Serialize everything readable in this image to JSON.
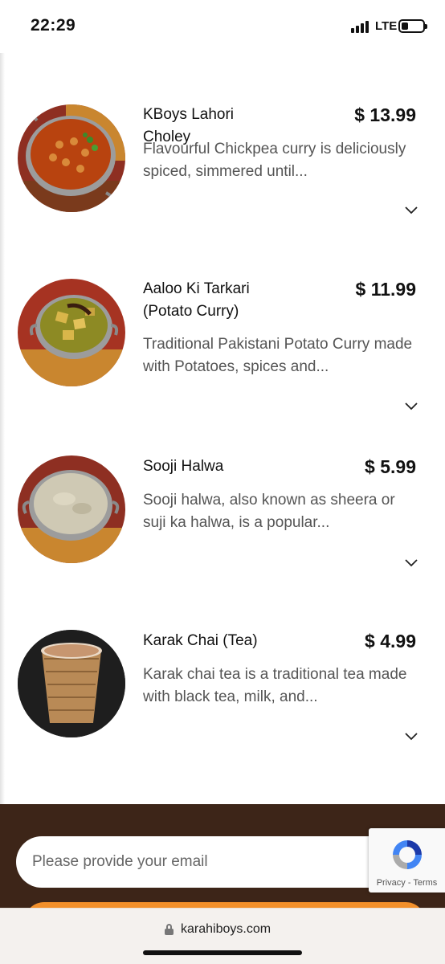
{
  "status_bar": {
    "time": "22:29",
    "network": "LTE"
  },
  "menu": {
    "items": [
      {
        "name": "KBoys Lahori Choley",
        "price": "$ 13.99",
        "description": "Flavourful Chickpea curry is deliciously spiced, simmered until...",
        "image_icon": "chickpea-curry-bowl"
      },
      {
        "name": "Aaloo Ki Tarkari (Potato Curry)",
        "price": "$ 11.99",
        "description": "Traditional Pakistani Potato Curry made with Potatoes, spices and...",
        "image_icon": "potato-curry-bowl"
      },
      {
        "name": "Sooji Halwa",
        "price": "$ 5.99",
        "description": "Sooji halwa, also known as sheera or suji ka halwa, is a popular...",
        "image_icon": "halwa-bowl"
      },
      {
        "name": "Karak Chai (Tea)",
        "price": "$ 4.99",
        "description": "Karak chai tea is a traditional tea made with black tea, milk, and...",
        "image_icon": "chai-cup"
      }
    ]
  },
  "newsletter": {
    "email_placeholder": "Please provide your email"
  },
  "recaptcha": {
    "privacy": "Privacy",
    "separator": " - ",
    "terms": "Terms"
  },
  "browser": {
    "domain": "karahiboys.com"
  },
  "colors": {
    "footer": "#3d2518",
    "accent": "#f2902b",
    "price": "#111111",
    "description": "#555555"
  }
}
